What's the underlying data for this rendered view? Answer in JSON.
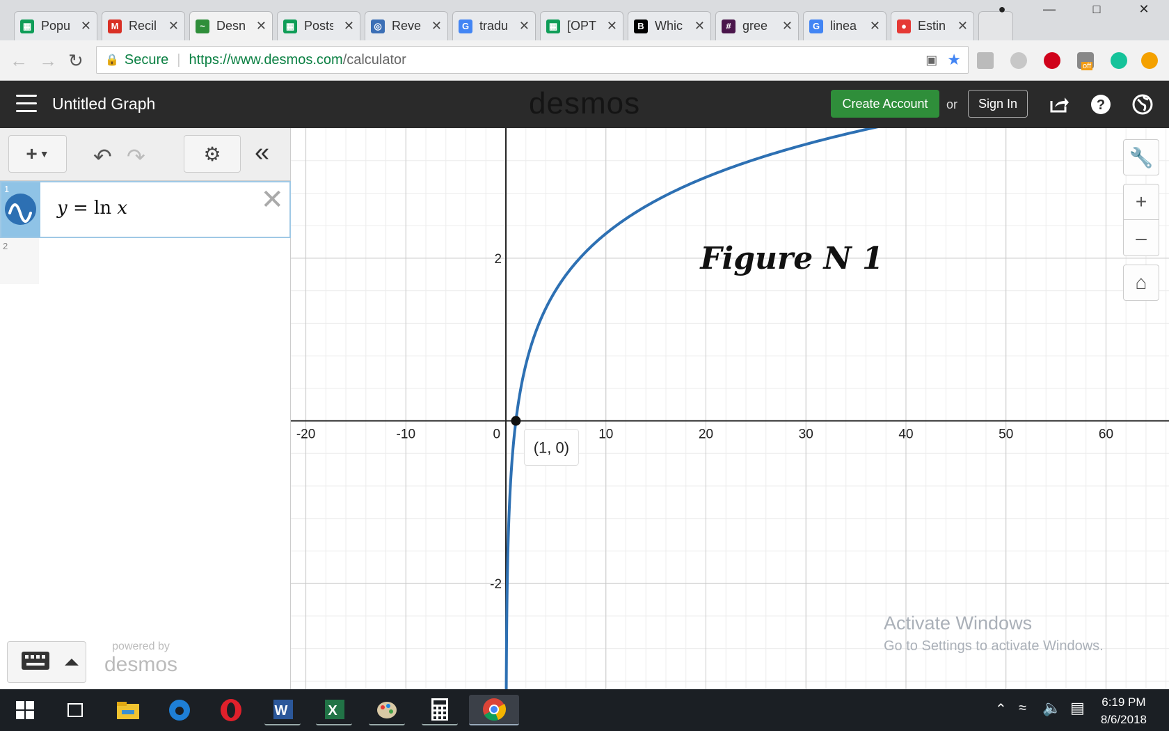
{
  "browser": {
    "tabs": [
      {
        "title": "Popu",
        "color": "#0f9d58",
        "glyph": "▦"
      },
      {
        "title": "Recil",
        "color": "#d93025",
        "glyph": "M"
      },
      {
        "title": "Desn",
        "color": "#2f8e3a",
        "glyph": "~",
        "active": true
      },
      {
        "title": "Posts",
        "color": "#0f9d58",
        "glyph": "▦"
      },
      {
        "title": "Reve",
        "color": "#3b6fb6",
        "glyph": "◎"
      },
      {
        "title": "tradu",
        "color": "#4285f4",
        "glyph": "G"
      },
      {
        "title": "[OPT",
        "color": "#0f9d58",
        "glyph": "▦"
      },
      {
        "title": "Whic",
        "color": "#000000",
        "glyph": "B"
      },
      {
        "title": "gree",
        "color": "#4a154b",
        "glyph": "#"
      },
      {
        "title": "linea",
        "color": "#4285f4",
        "glyph": "G"
      },
      {
        "title": "Estin",
        "color": "#e53935",
        "glyph": "●"
      }
    ],
    "secure_label": "Secure",
    "url_prefix": "https://www.desmos.com",
    "url_path": "/calculator",
    "ext_badge": "off"
  },
  "header": {
    "graph_title": "Untitled Graph",
    "logo": "desmos",
    "create_account": "Create Account",
    "or": "or",
    "sign_in": "Sign In"
  },
  "expressions": [
    {
      "index": "1",
      "latex_text": "y = ln x",
      "color": "#2d70b3"
    },
    {
      "index": "2",
      "latex_text": ""
    }
  ],
  "panel_footer": {
    "powered_by": "powered by",
    "brand": "desmos"
  },
  "graph": {
    "annotation": "Figure N 1",
    "point_label": "(1, 0)",
    "watermark_line1": "Activate Windows",
    "watermark_line2": "Go to Settings to activate Windows."
  },
  "chart_data": {
    "type": "line",
    "title": "",
    "xlabel": "",
    "ylabel": "",
    "xlim": [
      -21.5,
      66.3
    ],
    "ylim": [
      -3.3,
      3.6
    ],
    "x_ticks": [
      -20,
      -10,
      0,
      10,
      20,
      30,
      40,
      50,
      60
    ],
    "y_ticks": [
      -2,
      2
    ],
    "grid": true,
    "series": [
      {
        "name": "y = ln x",
        "function": "ln",
        "color": "#2d70b3",
        "x": [
          0.04,
          0.1,
          0.3,
          0.5,
          1,
          2,
          3,
          5,
          7,
          10,
          15,
          20,
          25,
          30,
          37
        ],
        "y": [
          -3.22,
          -2.3,
          -1.2,
          -0.69,
          0,
          0.69,
          1.1,
          1.61,
          1.95,
          2.3,
          2.71,
          3.0,
          3.22,
          3.4,
          3.61
        ]
      }
    ],
    "points": [
      {
        "x": 1,
        "y": 0,
        "label": "(1, 0)"
      }
    ]
  },
  "taskbar": {
    "time": "6:19 PM",
    "date": "8/6/2018"
  }
}
